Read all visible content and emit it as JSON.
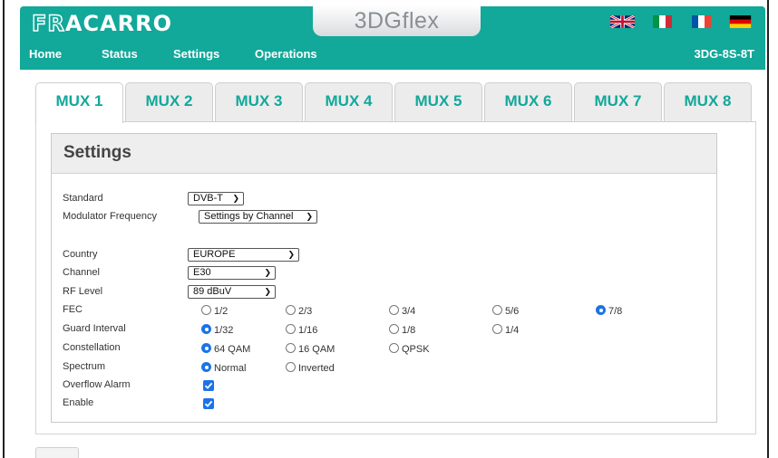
{
  "header": {
    "logo_part1": "FR",
    "logo_part2": "ACARRO",
    "product_title": "3DGflex",
    "device_id": "3DG-8S-8T",
    "nav": [
      "Home",
      "Status",
      "Settings",
      "Operations"
    ],
    "flags": [
      "uk-flag-icon",
      "italy-flag-icon",
      "france-flag-icon",
      "germany-flag-icon"
    ],
    "accent_color": "#12a89a"
  },
  "tabs": [
    "MUX 1",
    "MUX 2",
    "MUX 3",
    "MUX 4",
    "MUX 5",
    "MUX 6",
    "MUX 7",
    "MUX 8"
  ],
  "active_tab": "MUX 1",
  "settings": {
    "title": "Settings",
    "standard": {
      "label": "Standard",
      "value": "DVB-T"
    },
    "modulator_frequency": {
      "label": "Modulator Frequency",
      "value": "Settings by Channel"
    },
    "country": {
      "label": "Country",
      "value": "EUROPE"
    },
    "channel": {
      "label": "Channel",
      "value": "E30"
    },
    "rf_level": {
      "label": "RF Level",
      "value": "89 dBuV"
    },
    "fec": {
      "label": "FEC",
      "options": [
        "1/2",
        "2/3",
        "3/4",
        "5/6",
        "7/8"
      ],
      "selected": "7/8"
    },
    "guard_interval": {
      "label": "Guard Interval",
      "options": [
        "1/32",
        "1/16",
        "1/8",
        "1/4"
      ],
      "selected": "1/32"
    },
    "constellation": {
      "label": "Constellation",
      "options": [
        "64 QAM",
        "16 QAM",
        "QPSK"
      ],
      "selected": "64 QAM"
    },
    "spectrum": {
      "label": "Spectrum",
      "options": [
        "Normal",
        "Inverted"
      ],
      "selected": "Normal"
    },
    "overflow_alarm": {
      "label": "Overflow Alarm",
      "checked": true
    },
    "enable": {
      "label": "Enable",
      "checked": true
    }
  }
}
